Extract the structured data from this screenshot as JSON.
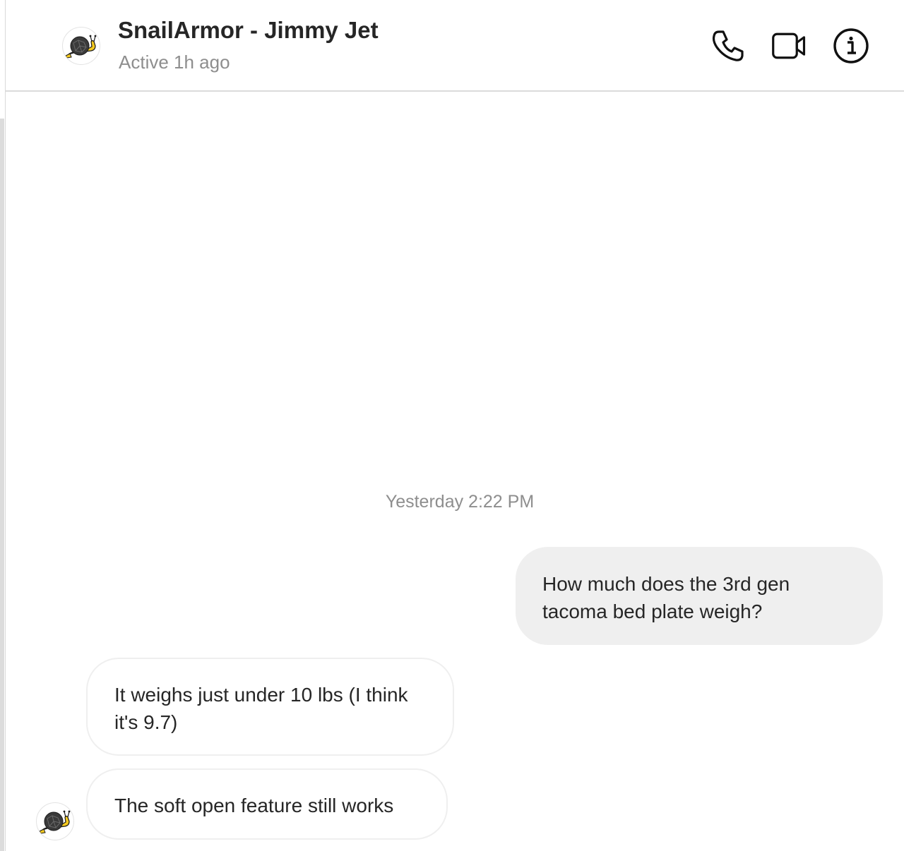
{
  "header": {
    "name": "SnailArmor - Jimmy Jet",
    "status": "Active 1h ago",
    "icons": [
      "phone-icon",
      "video-camera-icon",
      "info-icon"
    ]
  },
  "thread": {
    "timestamp": "Yesterday 2:22 PM",
    "messages": [
      {
        "direction": "outgoing",
        "text": "How much does the 3rd gen tacoma bed plate weigh?"
      },
      {
        "direction": "incoming",
        "text": "It weighs just under 10 lbs (I think it's 9.7)"
      },
      {
        "direction": "incoming",
        "text": "The soft open feature still works"
      }
    ]
  },
  "colors": {
    "outgoing_bubble": "#efefef",
    "incoming_border": "#efefef",
    "secondary_text": "#8e8e8e",
    "primary_text": "#262626",
    "snail_body": "#f4c920",
    "snail_shell": "#3a3a3a"
  }
}
